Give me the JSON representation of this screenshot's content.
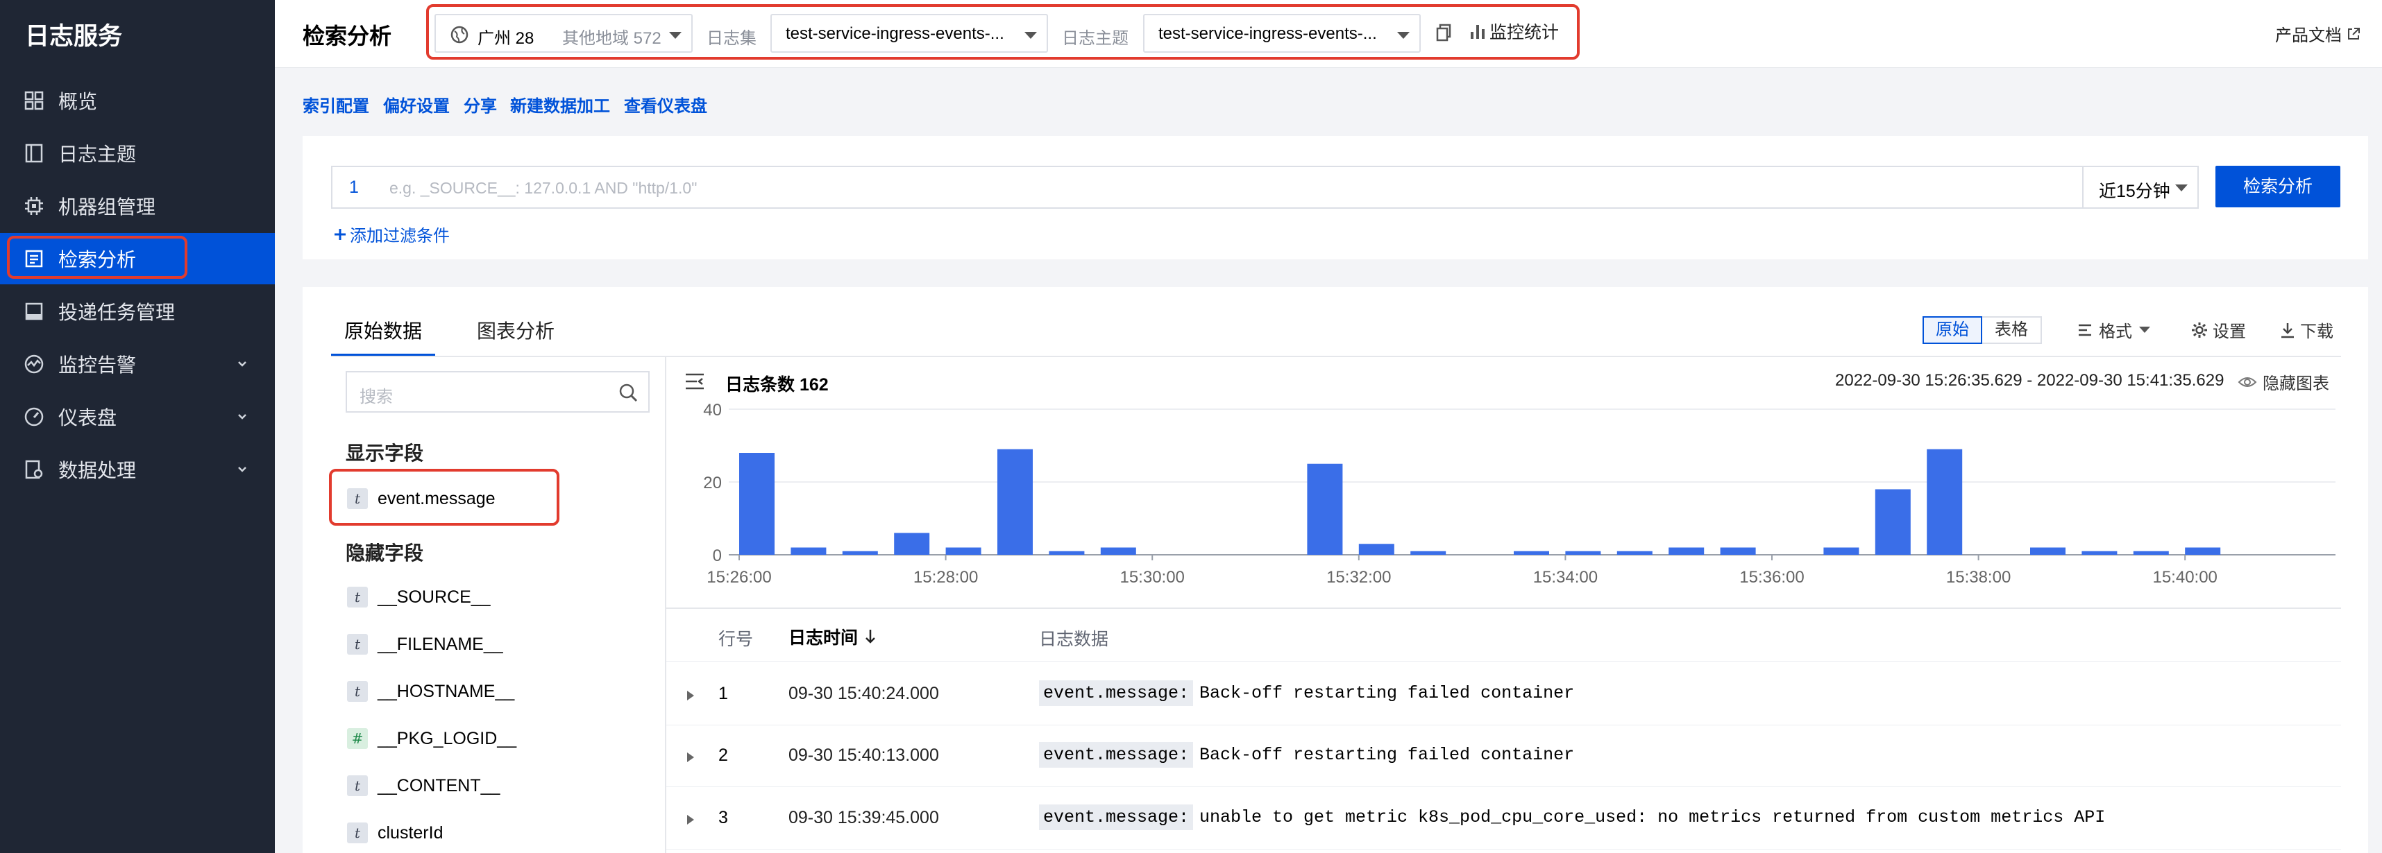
{
  "sidebar": {
    "title": "日志服务",
    "items": [
      {
        "label": "概览",
        "icon": "dashboard-grid-icon"
      },
      {
        "label": "日志主题",
        "icon": "topic-icon"
      },
      {
        "label": "机器组管理",
        "icon": "chip-icon"
      },
      {
        "label": "检索分析",
        "icon": "search-analysis-icon",
        "active": true
      },
      {
        "label": "投递任务管理",
        "icon": "delivery-icon"
      },
      {
        "label": "监控告警",
        "icon": "monitor-alert-icon",
        "expandable": true
      },
      {
        "label": "仪表盘",
        "icon": "gauge-icon",
        "expandable": true
      },
      {
        "label": "数据处理",
        "icon": "data-process-icon",
        "expandable": true
      }
    ]
  },
  "header": {
    "title": "检索分析",
    "region": "广州 28",
    "other_regions": "其他地域 572",
    "logset_label": "日志集",
    "logset_value": "test-service-ingress-events-...",
    "topic_label": "日志主题",
    "topic_value": "test-service-ingress-events-...",
    "monitor_label": "监控统计",
    "docs_label": "产品文档"
  },
  "actions": [
    "索引配置",
    "偏好设置",
    "分享",
    "新建数据加工",
    "查看仪表盘"
  ],
  "query": {
    "line_number": "1",
    "placeholder": "e.g. _SOURCE__: 127.0.0.1 AND \"http/1.0\"",
    "time_range": "近15分钟",
    "search_button": "检索分析",
    "add_filter": "添加过滤条件"
  },
  "tabs": {
    "raw": "原始数据",
    "chart": "图表分析"
  },
  "view_toggle": {
    "raw": "原始",
    "table": "表格"
  },
  "toolbar": {
    "format": "格式",
    "settings": "设置",
    "download": "下载"
  },
  "fields": {
    "search_placeholder": "搜索",
    "shown_title": "显示字段",
    "shown": [
      {
        "type": "t",
        "name": "event.message"
      }
    ],
    "hidden_title": "隐藏字段",
    "hidden": [
      {
        "type": "t",
        "name": "__SOURCE__"
      },
      {
        "type": "t",
        "name": "__FILENAME__"
      },
      {
        "type": "t",
        "name": "__HOSTNAME__"
      },
      {
        "type": "#",
        "name": "__PKG_LOGID__"
      },
      {
        "type": "t",
        "name": "__CONTENT__"
      },
      {
        "type": "t",
        "name": "clusterId"
      }
    ]
  },
  "histogram": {
    "count_label": "日志条数 162",
    "time_range": "2022-09-30 15:26:35.629 - 2022-09-30 15:41:35.629",
    "hide_label": "隐藏图表"
  },
  "chart_data": {
    "type": "bar",
    "x_unit": "30s bins from 15:26:00",
    "yticks": [
      0,
      20,
      40
    ],
    "ylim": [
      0,
      40
    ],
    "xticks": [
      "15:26:00",
      "15:28:00",
      "15:30:00",
      "15:32:00",
      "15:34:00",
      "15:36:00",
      "15:38:00",
      "15:40:00"
    ],
    "values": [
      28,
      2,
      1,
      6,
      2,
      29,
      1,
      2,
      0,
      0,
      0,
      25,
      3,
      1,
      0,
      1,
      1,
      1,
      2,
      2,
      0,
      2,
      18,
      29,
      0,
      2,
      1,
      1,
      2
    ],
    "color": "#3a6ee8"
  },
  "table": {
    "col_row": "行号",
    "col_time": "日志时间",
    "col_data": "日志数据",
    "rows": [
      {
        "num": "1",
        "time": "09-30 15:40:24.000",
        "key": "event.message:",
        "msg": "Back-off restarting failed container"
      },
      {
        "num": "2",
        "time": "09-30 15:40:13.000",
        "key": "event.message:",
        "msg": "Back-off restarting failed container"
      },
      {
        "num": "3",
        "time": "09-30 15:39:45.000",
        "key": "event.message:",
        "msg": "unable to get metric k8s_pod_cpu_core_used: no metrics returned from custom metrics API"
      }
    ]
  }
}
